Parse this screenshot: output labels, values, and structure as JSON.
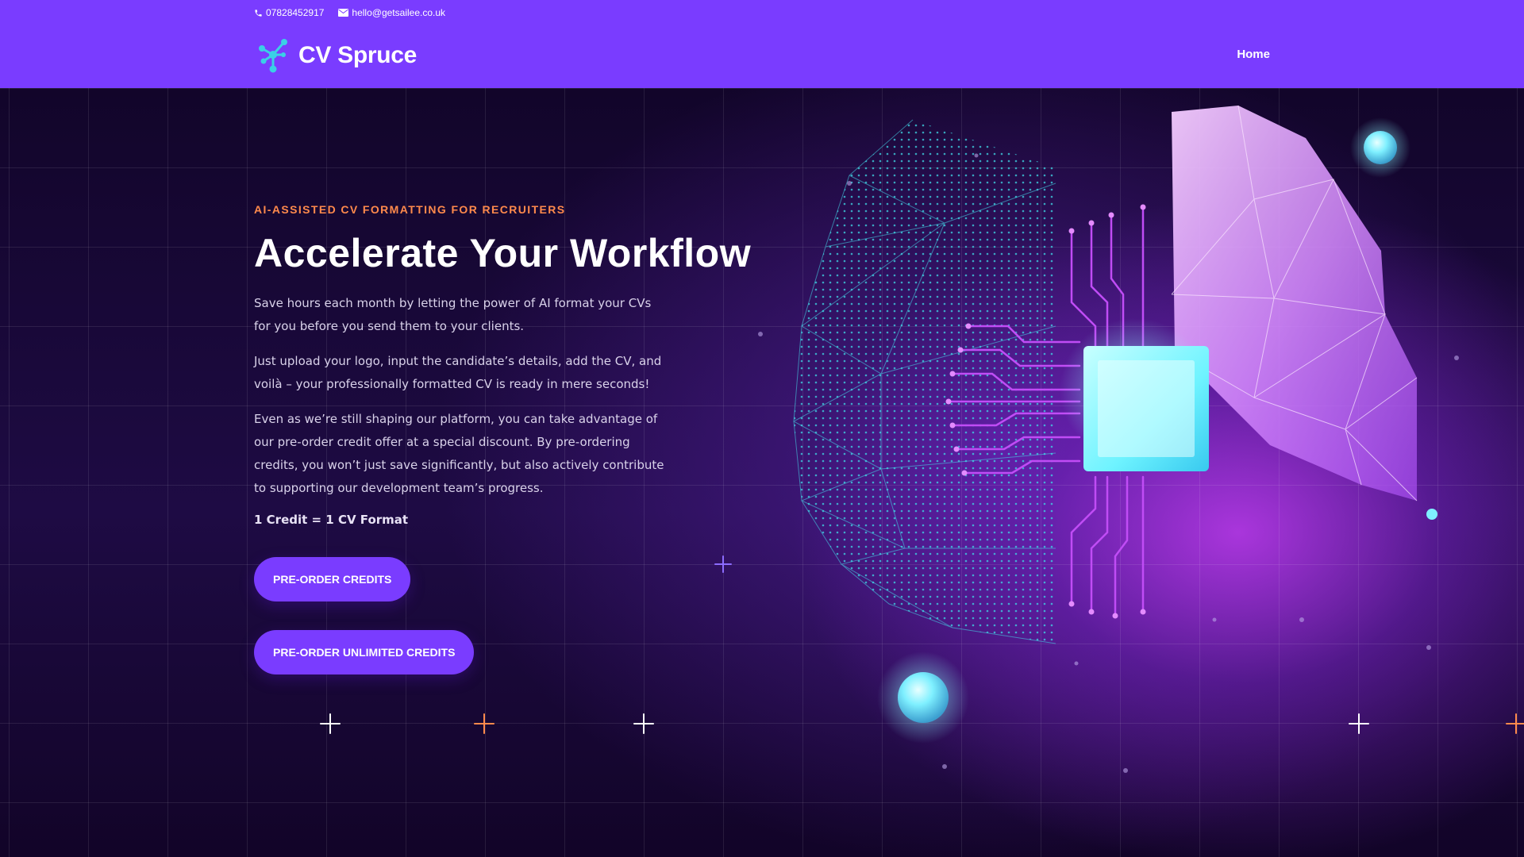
{
  "topbar": {
    "phone": "07828452917",
    "email": "hello@getsailee.co.uk"
  },
  "brand": {
    "name": "CV Spruce"
  },
  "nav": {
    "items": [
      "Home"
    ]
  },
  "hero": {
    "eyebrow": "AI-ASSISTED CV FORMATTING FOR RECRUITERS",
    "title": "Accelerate Your Workflow",
    "paragraphs": [
      "Save hours each month by letting the power of AI format your CVs for you before you send them to your clients.",
      "Just upload your logo, input the candidate’s details, add the CV, and voilà – your professionally formatted CV is ready in mere seconds!",
      "Even as we’re still shaping our platform, you can take advantage of our pre-order credit offer at a special discount. By pre-ordering credits, you won’t just save significantly, but also actively contribute to supporting our development team’s progress."
    ],
    "credit_note": "1 Credit = 1 CV Format",
    "buttons": {
      "preorder_credits": "PRE-ORDER CREDITS",
      "preorder_unlimited": "PRE-ORDER UNLIMITED CREDITS"
    }
  },
  "colors": {
    "header_bg": "#7a3cff",
    "accent_orange": "#ff8a4c",
    "button_bg": "#7a3cff",
    "chip_cyan": "#7ff6ff"
  },
  "icons": [
    "phone-icon",
    "email-icon",
    "molecule-logo-icon"
  ]
}
